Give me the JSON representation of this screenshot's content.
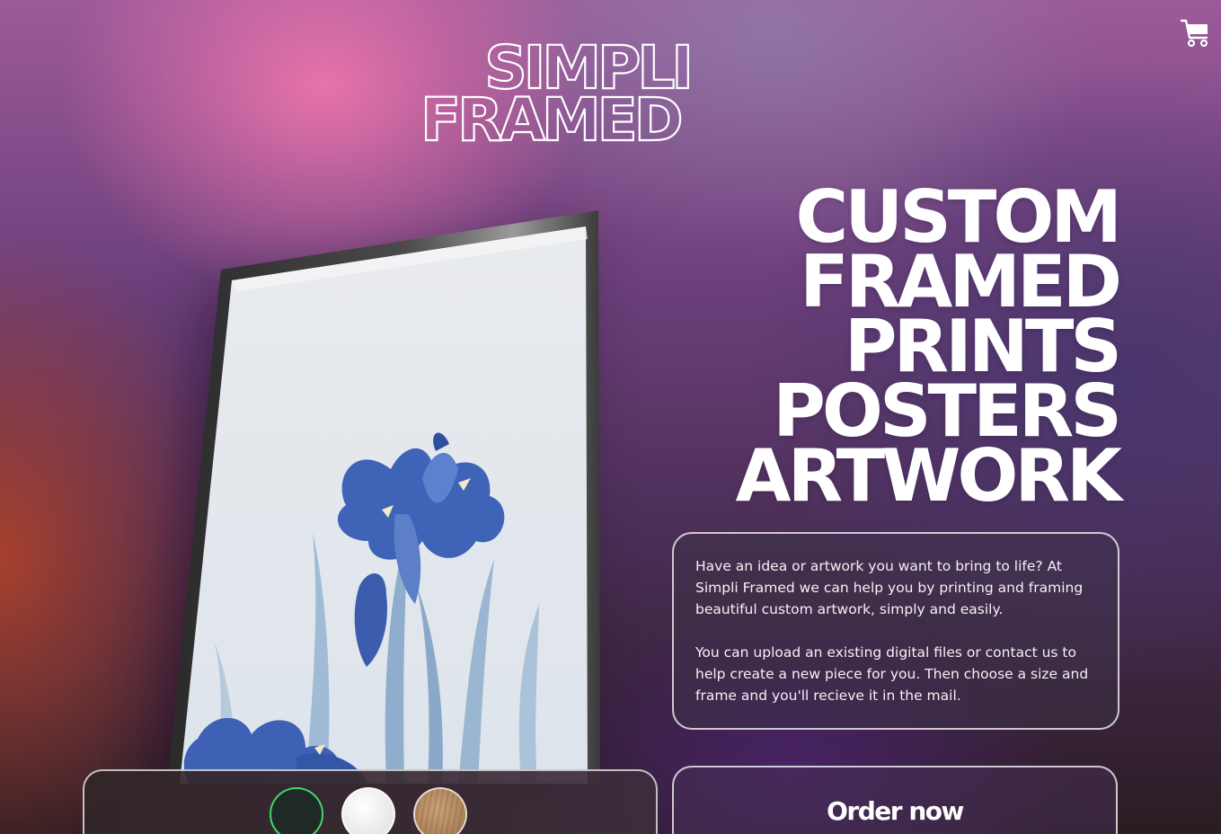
{
  "brand": {
    "logo_line1": "SIMPLI",
    "logo_line2": "FRAMED"
  },
  "header": {
    "cart_icon": "shopping-cart-icon"
  },
  "hero": {
    "headline": [
      "CUSTOM",
      "FRAMED",
      "PRINTS",
      "POSTERS",
      "ARTWORK"
    ],
    "description": [
      "Have an idea or artwork you want to bring to life? At Simpli Framed we can help you by printing and framing beautiful custom artwork, simply and easily.",
      "You can upload an existing digital files or contact us to help create a new piece for you. Then choose a size and frame and you'll recieve it in the mail."
    ],
    "order_label": "Order now"
  },
  "frame_picker": {
    "options": [
      {
        "name": "black",
        "color": "#1f2a26",
        "selected": true
      },
      {
        "name": "white",
        "color": "#f2f2f2",
        "selected": false
      },
      {
        "name": "oak",
        "color": "#b88e63",
        "selected": false
      }
    ],
    "selected_ring_color": "#3fd66e"
  }
}
